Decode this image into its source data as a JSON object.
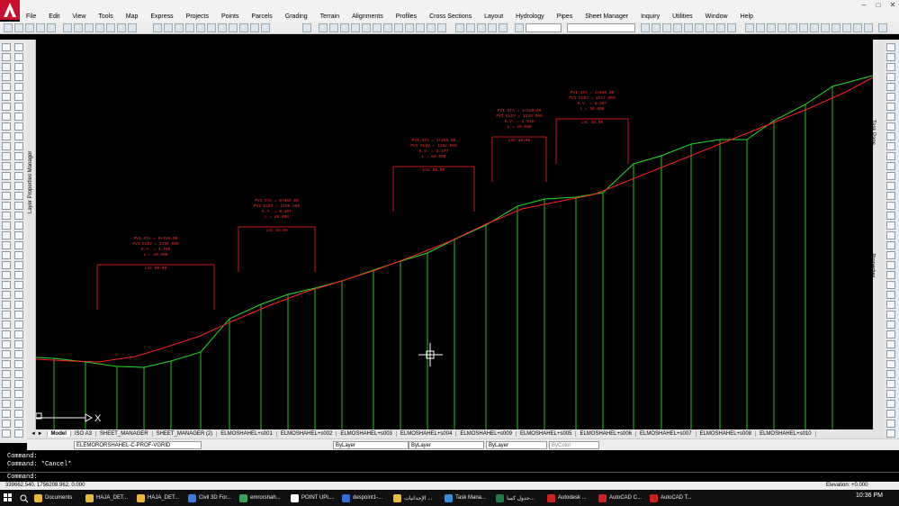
{
  "app": {
    "logo_letter": "A"
  },
  "window_controls": {
    "min": "–",
    "max": "□",
    "close": "✕"
  },
  "menu": [
    "File",
    "Edit",
    "View",
    "Tools",
    "Map",
    "Express",
    "Projects",
    "Points",
    "Parcels",
    "Grading",
    "Terrain",
    "Alignments",
    "Profiles",
    "Cross Sections",
    "Layout",
    "Hydrology",
    "Pipes",
    "Sheet Manager",
    "Inquiry",
    "Utilities",
    "Window",
    "Help"
  ],
  "panels": {
    "layer_properties": "Layer Properties Manager",
    "task_pane": "Task Pane",
    "properties": "Properties"
  },
  "tabs": [
    "Model",
    "ISO A3",
    "SHEET_MANAGER",
    "SHEET_MANAGER (2)",
    "ELMOSHAHEL+s001",
    "ELMOSHAHEL+s002",
    "ELMOSHAHEL+s003",
    "ELMOSHAHEL+s004",
    "ELMOSHAHEL+s009",
    "ELMOSHAHEL+s005",
    "ELMOSHAHEL+s006",
    "ELMOSHAHEL+s007",
    "ELMOSHAHEL+s008",
    "ELMOSHAHEL+s010"
  ],
  "props": {
    "layer": "ELEMORORSHAHEL-C-PROF-VGRID",
    "color": "ByLayer",
    "linetype": "ByLayer",
    "lineweight": "ByLayer",
    "plotstyle": "ByColor"
  },
  "command": {
    "history": [
      "Command:",
      "Command: *Cancel*"
    ],
    "prompt": "Command:"
  },
  "status": {
    "coords": "339662.540, 1756208.962, 0.000",
    "elevation": "Elevation: +0.000"
  },
  "taskbar": {
    "items": [
      {
        "label": "Documents",
        "color": "#e8b93a"
      },
      {
        "label": "HAJA_DET...",
        "color": "#e8b93a"
      },
      {
        "label": "HAJA_DET...",
        "color": "#e8b93a"
      },
      {
        "label": "Civil 3D For...",
        "color": "#3d7be0"
      },
      {
        "label": "emrorshah...",
        "color": "#3aa35a"
      },
      {
        "label": "POINT UPL...",
        "color": "#ffffff"
      },
      {
        "label": "despoint1-...",
        "color": "#2f6fd6"
      },
      {
        "label": "الإحداثيات ...",
        "color": "#e8b93a"
      },
      {
        "label": "Task Mana...",
        "color": "#3b8fd9"
      },
      {
        "label": "جدول كميا...",
        "color": "#1d7b45"
      },
      {
        "label": "Autodesk ...",
        "color": "#cc2222"
      },
      {
        "label": "AutoCAD C...",
        "color": "#cc2222"
      },
      {
        "label": "AutoCAD T...",
        "color": "#cc2222"
      }
    ],
    "clock": "10:36 PM"
  },
  "drawing": {
    "ucs_x": "X",
    "curves": [
      {
        "line1": "PVI STA = 0+740.00",
        "line2": "PVI ELEV = 2190.000",
        "line3": "K.V. = 4.750",
        "line4": "L = 30.000",
        "line5": "LVC 60.00"
      },
      {
        "line1": "PVI STA = 0+960.00",
        "line2": "PVI ELEV = 2196.860",
        "line3": "K.V. = 6.107",
        "line4": "L = 40.000",
        "line5": "LVC 40.00"
      },
      {
        "line1": "PVI STA = 1+250.00",
        "line2": "PVI ELEV = 2202.500",
        "line3": "K.V. = 3.377",
        "line4": "L = 60.000",
        "line5": "LVC 60.00"
      },
      {
        "line1": "PVI STA = 1+510.00",
        "line2": "PVI ELEV = 2210.600",
        "line3": "K.V. = 4.910",
        "line4": "L = 40.000",
        "line5": "LVC 40.00"
      },
      {
        "line1": "PVI STA = 1+630.00",
        "line2": "PVI ELEV = 2217.000",
        "line3": "K.V. = 8.207",
        "line4": "L = 30.000",
        "line5": "LVC 30.00"
      }
    ]
  }
}
